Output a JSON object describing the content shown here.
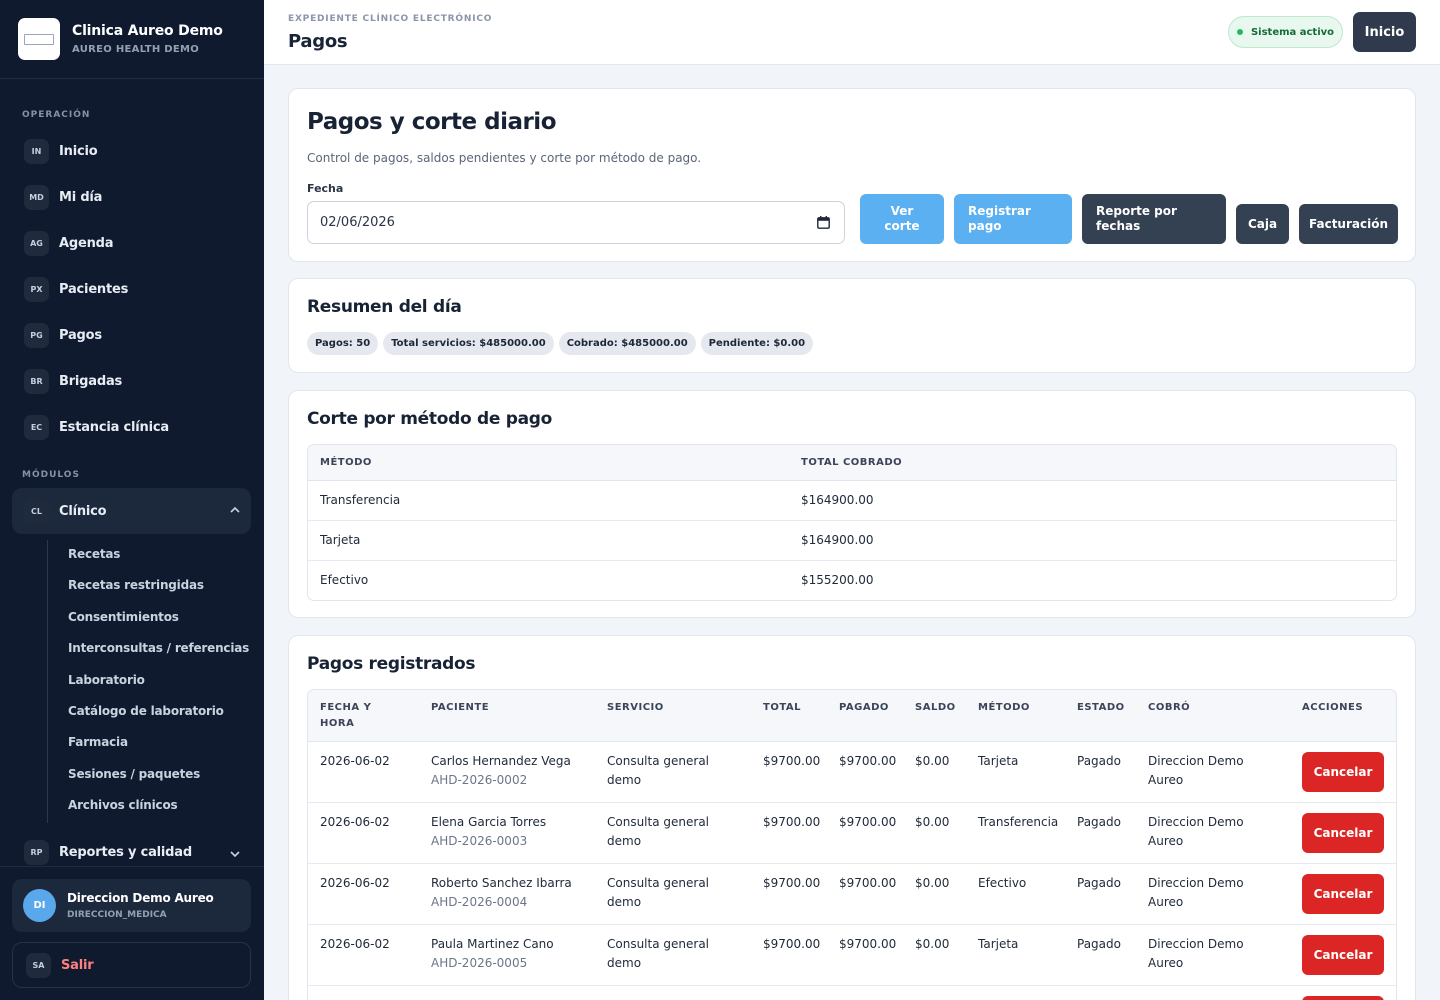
{
  "brand": {
    "name": "Clinica Aureo Demo",
    "subtitle": "AUREO HEALTH DEMO"
  },
  "sidebar": {
    "section_operacion": "OPERACIÓN",
    "section_modulos": "MÓDULOS",
    "items": [
      {
        "badge": "IN",
        "label": "Inicio"
      },
      {
        "badge": "MD",
        "label": "Mi día"
      },
      {
        "badge": "AG",
        "label": "Agenda"
      },
      {
        "badge": "PX",
        "label": "Pacientes"
      },
      {
        "badge": "PG",
        "label": "Pagos"
      },
      {
        "badge": "BR",
        "label": "Brigadas"
      },
      {
        "badge": "EC",
        "label": "Estancia clínica"
      }
    ],
    "clinico": {
      "badge": "CL",
      "label": "Clínico"
    },
    "clinico_sub": [
      "Recetas",
      "Recetas restringidas",
      "Consentimientos",
      "Interconsultas / referencias",
      "Laboratorio",
      "Catálogo de laboratorio",
      "Farmacia",
      "Sesiones / paquetes",
      "Archivos clínicos"
    ],
    "reportes": {
      "badge": "RP",
      "label": "Reportes y calidad"
    }
  },
  "user": {
    "initials": "DI",
    "name": "Direccion Demo Aureo",
    "role": "DIRECCION_MEDICA"
  },
  "logout": {
    "badge": "SA",
    "label": "Salir"
  },
  "topbar": {
    "eyebrow": "EXPEDIENTE CLÍNICO ELECTRÓNICO",
    "title": "Pagos",
    "status": "Sistema activo",
    "home_label": "Inicio"
  },
  "header_card": {
    "title": "Pagos y corte diario",
    "description": "Control de pagos, saldos pendientes y corte por método de pago.",
    "date_label": "Fecha",
    "date_value": "02/06/2026",
    "buttons": {
      "ver_corte": [
        "Ver",
        "corte"
      ],
      "registrar": [
        "Registrar",
        "pago"
      ],
      "reporte": [
        "Reporte por",
        "fechas"
      ],
      "caja": "Caja",
      "facturacion": "Facturación"
    }
  },
  "resumen": {
    "title": "Resumen del día",
    "chips": [
      "Pagos: 50",
      "Total servicios: $485000.00",
      "Cobrado: $485000.00",
      "Pendiente: $0.00"
    ]
  },
  "corte": {
    "title": "Corte por método de pago",
    "headers": [
      "MÉTODO",
      "TOTAL COBRADO"
    ],
    "rows": [
      [
        "Transferencia",
        "$164900.00"
      ],
      [
        "Tarjeta",
        "$164900.00"
      ],
      [
        "Efectivo",
        "$155200.00"
      ]
    ]
  },
  "pagos": {
    "title": "Pagos registrados",
    "headers": [
      "FECHA Y HORA",
      "PACIENTE",
      "SERVICIO",
      "TOTAL",
      "PAGADO",
      "SALDO",
      "MÉTODO",
      "ESTADO",
      "COBRÓ",
      "ACCIONES"
    ],
    "action_label": "Cancelar",
    "rows": [
      {
        "fecha": "2026-06-02",
        "paciente": "Carlos Hernandez Vega",
        "id": "AHD-2026-0002",
        "servicio": "Consulta general demo",
        "total": "$9700.00",
        "pagado": "$9700.00",
        "saldo": "$0.00",
        "metodo": "Tarjeta",
        "estado": "Pagado",
        "cobro": "Direccion Demo Aureo"
      },
      {
        "fecha": "2026-06-02",
        "paciente": "Elena Garcia Torres",
        "id": "AHD-2026-0003",
        "servicio": "Consulta general demo",
        "total": "$9700.00",
        "pagado": "$9700.00",
        "saldo": "$0.00",
        "metodo": "Transferencia",
        "estado": "Pagado",
        "cobro": "Direccion Demo Aureo"
      },
      {
        "fecha": "2026-06-02",
        "paciente": "Roberto Sanchez Ibarra",
        "id": "AHD-2026-0004",
        "servicio": "Consulta general demo",
        "total": "$9700.00",
        "pagado": "$9700.00",
        "saldo": "$0.00",
        "metodo": "Efectivo",
        "estado": "Pagado",
        "cobro": "Direccion Demo Aureo"
      },
      {
        "fecha": "2026-06-02",
        "paciente": "Paula Martinez Cano",
        "id": "AHD-2026-0005",
        "servicio": "Consulta general demo",
        "total": "$9700.00",
        "pagado": "$9700.00",
        "saldo": "$0.00",
        "metodo": "Tarjeta",
        "estado": "Pagado",
        "cobro": "Direccion Demo Aureo"
      }
    ]
  }
}
